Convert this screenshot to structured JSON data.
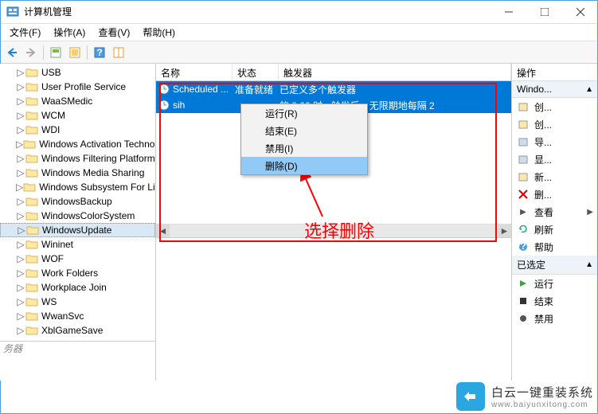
{
  "window": {
    "title": "计算机管理"
  },
  "menubar": [
    "文件(F)",
    "操作(A)",
    "查看(V)",
    "帮助(H)"
  ],
  "tree": {
    "items": [
      "USB",
      "User Profile Service",
      "WaaSMedic",
      "WCM",
      "WDI",
      "Windows Activation Technologies",
      "Windows Filtering Platform",
      "Windows Media Sharing",
      "Windows Subsystem For Linux",
      "WindowsBackup",
      "WindowsColorSystem",
      "WindowsUpdate",
      "Wininet",
      "WOF",
      "Work Folders",
      "Workplace Join",
      "WS",
      "WwanSvc",
      "XblGameSave"
    ],
    "selected_index": 11,
    "footer_cut": "务器"
  },
  "columns": {
    "name": "名称",
    "status": "状态",
    "trigger": "触发器"
  },
  "tasks": [
    {
      "name": "Scheduled ...",
      "status": "准备就绪",
      "trigger": "已定义多个触发器"
    },
    {
      "name": "sih",
      "status": "",
      "trigger": "的 8:00 时 - 触发后，无限期地每隔 2"
    }
  ],
  "context_menu": {
    "items": [
      "运行(R)",
      "结束(E)",
      "禁用(I)",
      "删除(D)"
    ],
    "highlighted_index": 3
  },
  "annotation": "选择删除",
  "actions_panel": {
    "title": "操作",
    "section1": "Windo...",
    "group1": [
      "创...",
      "创...",
      "导...",
      "显...",
      "新...",
      "删...",
      "查看",
      "刷新",
      "帮助"
    ],
    "section2": "已选定",
    "group2": [
      "运行",
      "结束",
      "禁用"
    ]
  },
  "watermark": {
    "line1": "白云一键重装系统",
    "line2": "www.baiyunxitong.com"
  }
}
